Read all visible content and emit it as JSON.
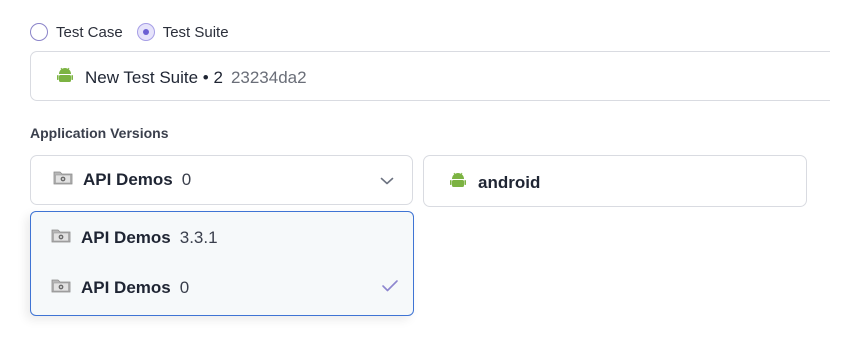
{
  "mode": {
    "options": [
      {
        "label": "Test Case",
        "selected": false
      },
      {
        "label": "Test Suite",
        "selected": true
      }
    ]
  },
  "suite": {
    "name": "New Test Suite • 2",
    "hash": "23234da2",
    "platform_icon": "android-icon"
  },
  "application_versions": {
    "label": "Application Versions",
    "selected": {
      "name": "API Demos",
      "version": "0"
    },
    "options": [
      {
        "name": "API Demos",
        "version": "3.3.1",
        "selected": false
      },
      {
        "name": "API Demos",
        "version": "0",
        "selected": true
      }
    ]
  },
  "platform": {
    "label": "android",
    "icon": "android-icon"
  },
  "colors": {
    "accent": "#6b5fd3",
    "focus_border": "#3f74d4",
    "android_green": "#7cb342"
  }
}
